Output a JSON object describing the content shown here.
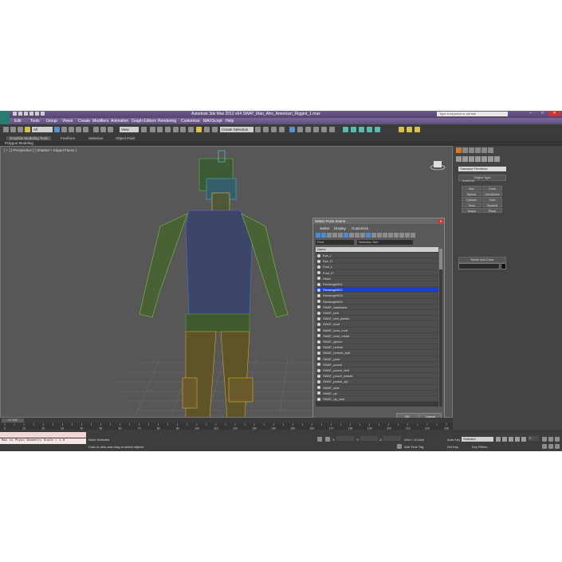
{
  "app": {
    "window_title": "Autodesk 3ds Max 2012 x64     SWAT_Man_Afro_American_Rigged_1.max",
    "search_placeholder": "Type a keyword or phrase",
    "menu": [
      "Edit",
      "Tools",
      "Group",
      "Views",
      "Create",
      "Modifiers",
      "Animation",
      "Graph Editors",
      "Rendering",
      "Customize",
      "MAXScript",
      "Help"
    ],
    "toolbar": {
      "selection_filter": "All",
      "reference_coord": "View",
      "named_selection": "Create Selection Se"
    },
    "ribbon_tabs": [
      "Graphite Modeling Tools",
      "Freeform",
      "Selection",
      "Object Paint"
    ],
    "ribbon_panel": "Polygon Modeling"
  },
  "viewport": {
    "label": "[ + ] [ Perspective ] [ Shaded + Edged Faces ]"
  },
  "command_panel": {
    "category": "Standard Primitives",
    "rollout_object_type": "Object Type",
    "autogrid_label": "AutoGrid",
    "objects": [
      "Box",
      "Cone",
      "Sphere",
      "GeoSphere",
      "Cylinder",
      "Tube",
      "Torus",
      "Pyramid",
      "Teapot",
      "Plane"
    ],
    "rollout_name_color": "Name and Color"
  },
  "dialog": {
    "title": "Select From Scene",
    "menu": [
      "Select",
      "Display",
      "Customize"
    ],
    "find_label": "Find:",
    "selection_set_label": "Selection Set:",
    "column_header": "Name",
    "items": [
      "Eye_L",
      "Eye_R",
      "Foot_L",
      "Foot_R",
      "Head",
      "Rectangle001",
      "Rectangle002",
      "Rectangle003",
      "Rectangle004",
      "SWAT_balaclava",
      "SWAT_belt",
      "SWAT_belt_plastic",
      "SWAT_boot",
      "SWAT_boot_cord",
      "SWAT_boot_metal",
      "SWAT_glover",
      "SWAT_helmet",
      "SWAT_helmet_belt",
      "SWAT_pant",
      "SWAT_pouch",
      "SWAT_pouch_belt",
      "SWAT_pouch_plastic",
      "SWAT_pouch_zip",
      "SWAT_side",
      "SWAT_up",
      "SWAT_up_vest"
    ],
    "selected_item": "Rectangle002",
    "ok_label": "OK",
    "cancel_label": "Cancel"
  },
  "timeline": {
    "slider_label": "0 / 100",
    "ticks": [
      "0",
      "5",
      "10",
      "15",
      "20",
      "25",
      "30",
      "35",
      "40",
      "45",
      "50",
      "55",
      "60",
      "65",
      "70",
      "75",
      "80",
      "85",
      "90",
      "95",
      "100",
      "105",
      "110",
      "115",
      "120",
      "125",
      "130",
      "135",
      "140",
      "145",
      "150",
      "155",
      "160",
      "165",
      "170",
      "175",
      "180",
      "185",
      "190",
      "195",
      "200",
      "205",
      "210",
      "215",
      "220",
      "225",
      "230"
    ]
  },
  "status": {
    "maxscript_line": "Max to Physx Geometry Scale = 1.0",
    "selection_status": "None Selected",
    "prompt": "Click or click-and-drag to select objects",
    "x_label": "X:",
    "y_label": "Y:",
    "z_label": "Z:",
    "grid": "Grid = 10,0cm",
    "add_time_tag": "Add Time Tag",
    "auto_key": "Auto Key",
    "set_key": "Set Key",
    "key_filters": "Key Filters...",
    "selected_combo": "Selected",
    "frame": "0"
  }
}
